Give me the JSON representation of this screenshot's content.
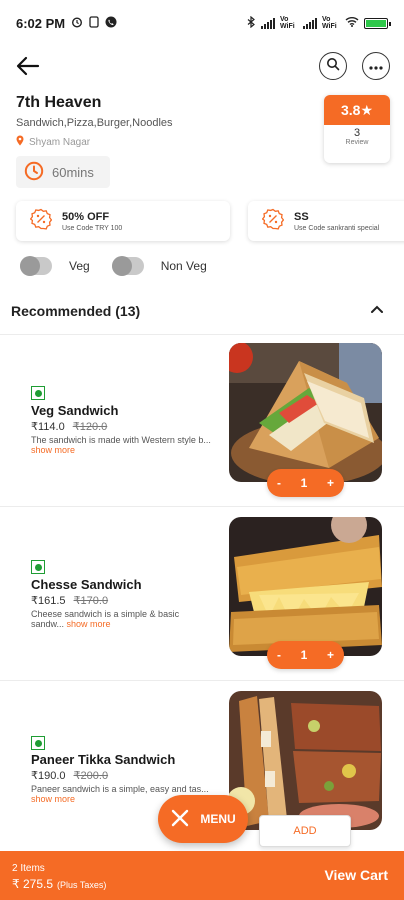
{
  "status_bar": {
    "time": "6:02 PM",
    "network_label_1": "Vo WiFi",
    "network_label_2": "Vo WiFi"
  },
  "restaurant": {
    "name": "7th Heaven",
    "cuisines": "Sandwich,Pizza,Burger,Noodles",
    "location": "Shyam Nagar",
    "delivery_time": "60mins",
    "rating": "3.8★",
    "review_count": "3",
    "review_label": "Review"
  },
  "offers": [
    {
      "title": "50% OFF",
      "code": "Use Code  TRY 100"
    },
    {
      "title": "SS",
      "code": "Use Code  sankranti special"
    }
  ],
  "filters": {
    "veg_label": "Veg",
    "nonveg_label": "Non Veg"
  },
  "section": {
    "title": "Recommended (13)"
  },
  "items": [
    {
      "name": "Veg Sandwich",
      "price": "₹114.0",
      "old_price": "₹120.0",
      "desc": "The sandwich is made with Western style b...",
      "show_more": "show more",
      "qty": "1",
      "minus": "-",
      "plus": "+"
    },
    {
      "name": "Chesse Sandwich",
      "price": "₹161.5",
      "old_price": "₹170.0",
      "desc": "Cheese sandwich is a simple & basic sandw...",
      "show_more": "show more",
      "qty": "1",
      "minus": "-",
      "plus": "+"
    },
    {
      "name": "Paneer Tikka Sandwich",
      "price": "₹190.0",
      "old_price": "₹200.0",
      "desc": "Paneer sandwich is a simple, easy and tas...",
      "show_more": "show more"
    }
  ],
  "fab": {
    "menu_label": "MENU",
    "add_label": "ADD"
  },
  "cart": {
    "count": "2 Items",
    "total": "₹ 275.5",
    "taxes": "(Plus Taxes)",
    "view_cart": "View Cart"
  },
  "colors": {
    "accent": "#f56b25",
    "veg": "#1f9d34"
  }
}
